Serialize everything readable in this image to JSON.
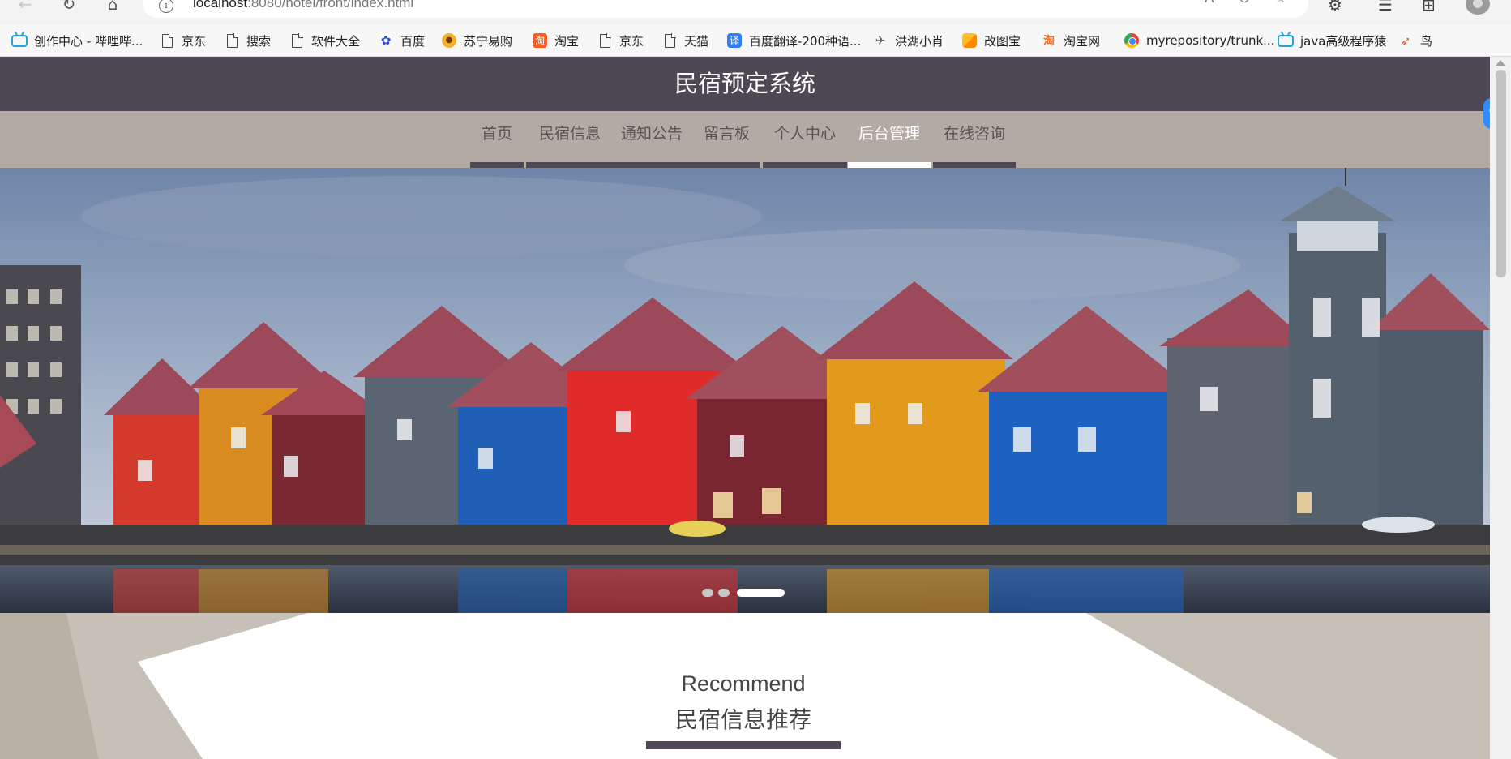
{
  "browser": {
    "url_host": "localhost",
    "url_rest": ":8080/hotel/front/index.html",
    "icons": {
      "back": "back-arrow-icon",
      "refresh": "refresh-icon",
      "home": "home-icon",
      "site_info": "info-icon",
      "read_aloud": "read-aloud-icon",
      "zoom": "zoom-out-icon",
      "favorites": "favorite-star-icon",
      "extensions": "puzzle-icon",
      "favorites_bar": "favorites-list-icon",
      "collections": "collections-icon",
      "profile": "avatar-icon"
    }
  },
  "bookmarks": [
    {
      "label": "创作中心 - 哔哩哔...",
      "icon": "bilibili-icon"
    },
    {
      "label": "京东",
      "icon": "page-icon"
    },
    {
      "label": "搜索",
      "icon": "page-icon"
    },
    {
      "label": "软件大全",
      "icon": "page-icon"
    },
    {
      "label": "百度",
      "icon": "baidu-paw-icon"
    },
    {
      "label": "苏宁易购",
      "icon": "suning-icon"
    },
    {
      "label": "淘宝",
      "icon": "taobao-icon"
    },
    {
      "label": "京东",
      "icon": "page-icon"
    },
    {
      "label": "天猫",
      "icon": "page-icon"
    },
    {
      "label": "百度翻译-200种语...",
      "icon": "translate-icon"
    },
    {
      "label": "洪湖小肖",
      "icon": "bird-icon"
    },
    {
      "label": "改图宝",
      "icon": "gaitubao-icon"
    },
    {
      "label": "淘宝网",
      "icon": "taobao-icon"
    },
    {
      "label": "myrepository/trunk...",
      "icon": "chrome-icon"
    },
    {
      "label": "java高级程序猿",
      "icon": "bilibili-icon"
    },
    {
      "label": "鸟",
      "icon": "kite-icon"
    }
  ],
  "site": {
    "title": "民宿预定系统"
  },
  "nav": {
    "items": [
      {
        "label": "首页",
        "active": false
      },
      {
        "label": "民宿信息",
        "active": false
      },
      {
        "label": "通知公告",
        "active": false
      },
      {
        "label": "留言板",
        "active": false
      },
      {
        "label": "个人中心",
        "active": false
      },
      {
        "label": "后台管理",
        "active": true
      },
      {
        "label": "在线咨询",
        "active": false
      }
    ]
  },
  "banner": {
    "slide_count": 3,
    "active_slide": 3
  },
  "recommend": {
    "title_en": "Recommend",
    "title_zh": "民宿信息推荐"
  },
  "colors": {
    "header_bg": "#4d4853",
    "nav_bg": "#b3aaa3",
    "nav_text": "#555555",
    "nav_active": "#ffffff",
    "accent": "#4d4853"
  }
}
